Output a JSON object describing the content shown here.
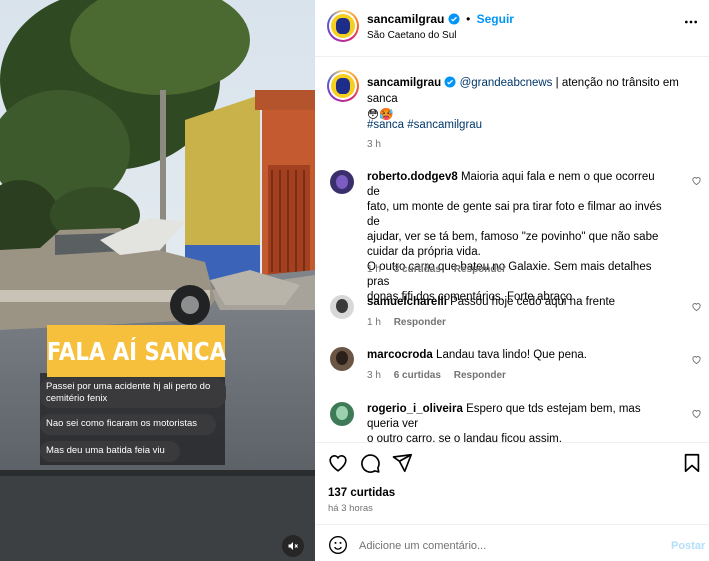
{
  "post": {
    "author": "sancamilgrau",
    "follow_label": "Seguir",
    "location": "São Caetano do Sul",
    "caption_mention": "@grandeabcnews",
    "caption_text": "| atenção no trânsito em sanca",
    "caption_emojis": "😳🥵",
    "hashtags": "#sanca #sancamilgrau",
    "time": "3 h",
    "likes": "137 curtidas",
    "posted_ago": "há 3 horas"
  },
  "media": {
    "banner": "FALA AÍ SANCA",
    "messages": [
      "Passei por uma acidente hj ali perto do cemitério fenix",
      "Nao sei como ficaram os motoristas",
      "Mas deu uma batida feia viu"
    ]
  },
  "comments": [
    {
      "user": "roberto.dodgev8",
      "text_lines": [
        "Maioria aqui fala e nem o que ocorreu de",
        "fato, um monte de gente sai pra tirar foto e filmar ao invés de",
        "ajudar, ver se tá bem, famoso \"ze povinho\" que não sabe",
        "cuidar da própria vida.",
        "O outro carro que bateu no Galaxie. Sem mais detalhes pras",
        "donas fifi dos comentários. Forte abraço"
      ],
      "time": "1 h",
      "likes": "3 curtidas",
      "reply": "Responder"
    },
    {
      "user": "samuelcharelli",
      "text_lines": [
        "Passou hoje cedo aqui na frente"
      ],
      "time": "1 h",
      "likes": "",
      "reply": "Responder"
    },
    {
      "user": "marcocroda",
      "text_lines": [
        "Landau tava lindo! Que pena."
      ],
      "time": "3 h",
      "likes": "6 curtidas",
      "reply": "Responder"
    },
    {
      "user": "rogerio_i_oliveira",
      "text_lines": [
        "Espero que tds estejam bem, mas queria ver",
        "o outro carro, se o landau ficou assim."
      ],
      "time": "",
      "likes": "",
      "reply": ""
    }
  ],
  "composer": {
    "placeholder": "Adicione um comentário...",
    "post_label": "Postar"
  },
  "icons": {
    "more": "more-horizontal-icon",
    "verified": "verified-badge-icon",
    "like": "heart-icon",
    "comment": "comment-icon",
    "share": "send-icon",
    "save": "bookmark-icon",
    "emoji": "emoji-icon",
    "mute": "speaker-muted-icon"
  },
  "colors": {
    "accent": "#0095f6",
    "banner": "#f7c03c"
  }
}
